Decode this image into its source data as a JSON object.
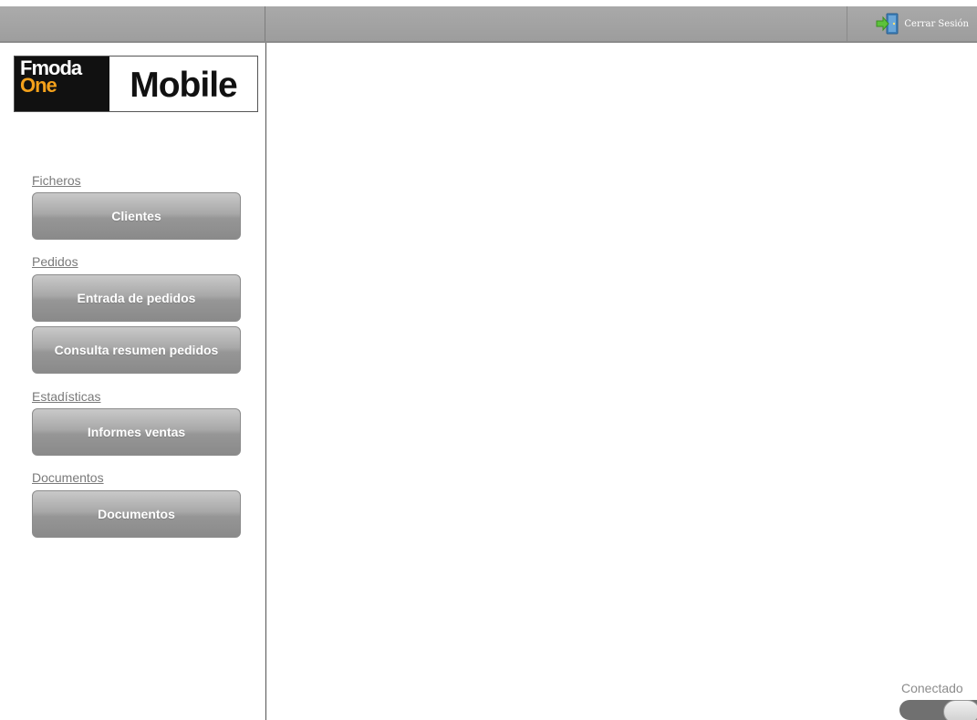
{
  "header": {
    "logout_label": "Cerrar Sesión",
    "logout_icon": "exit-door-icon"
  },
  "logo": {
    "line1": "Fmoda",
    "line2": "One",
    "product": "Mobile",
    "accent_color": "#f4a11b"
  },
  "sidebar": {
    "sections": [
      {
        "title": "Ficheros",
        "buttons": [
          "Clientes"
        ]
      },
      {
        "title": "Pedidos",
        "buttons": [
          "Entrada de pedidos",
          "Consulta resumen pedidos"
        ]
      },
      {
        "title": "Estadísticas",
        "buttons": [
          "Informes ventas"
        ]
      },
      {
        "title": "Documentos",
        "buttons": [
          "Documentos"
        ]
      }
    ]
  },
  "status": {
    "label": "Conectado",
    "toggle_on": true
  }
}
